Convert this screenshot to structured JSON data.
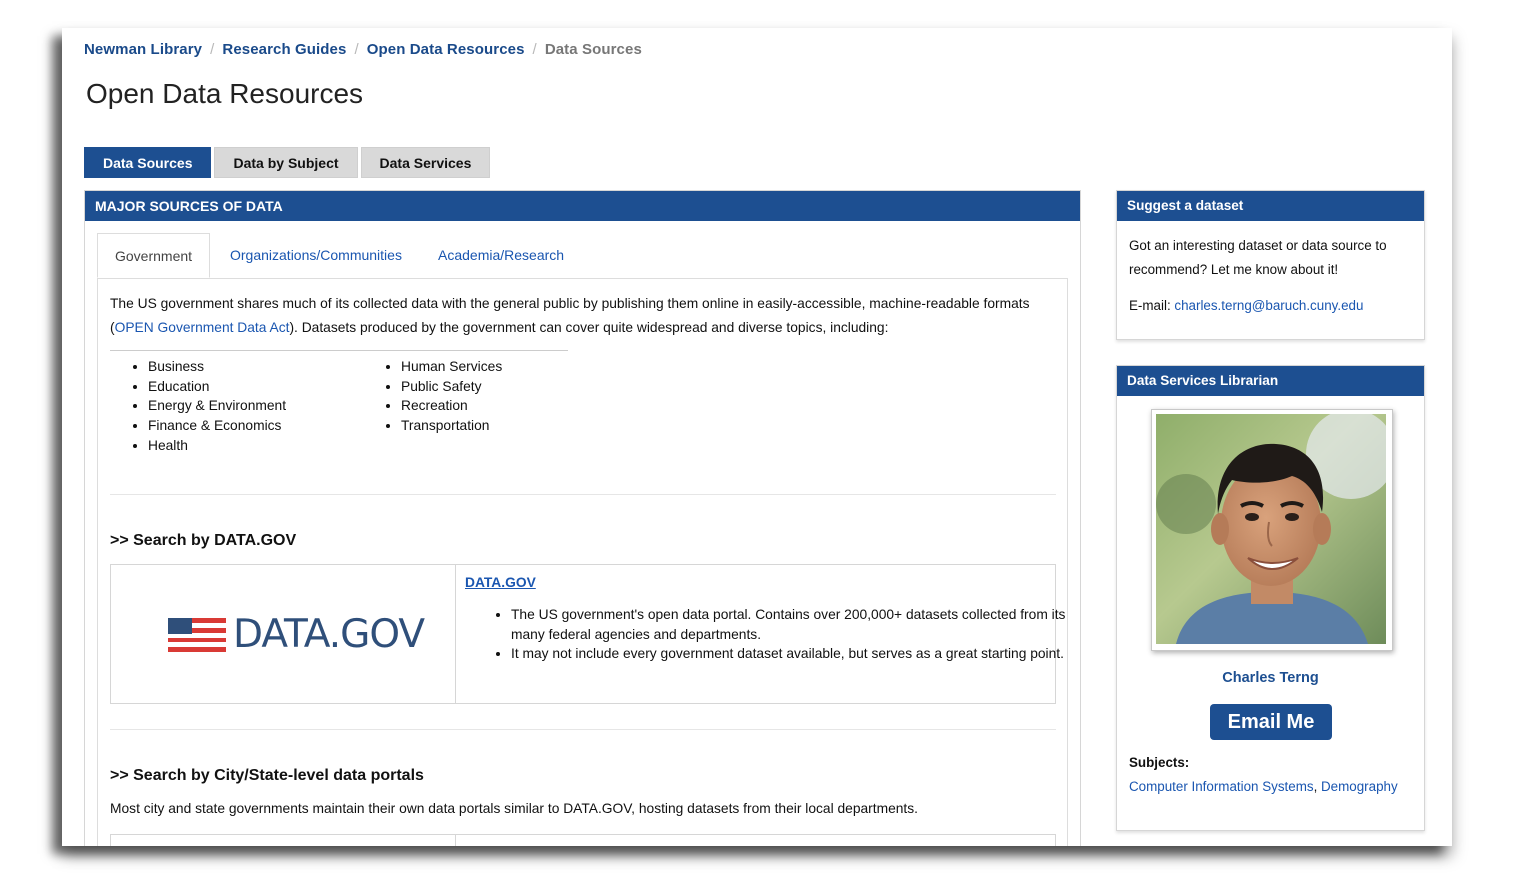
{
  "breadcrumb": {
    "items": [
      "Newman Library",
      "Research Guides",
      "Open Data Resources"
    ],
    "current": "Data Sources",
    "separator": "/"
  },
  "page_title": "Open Data Resources",
  "top_tabs": [
    "Data Sources",
    "Data by Subject",
    "Data Services"
  ],
  "main": {
    "header": "MAJOR SOURCES OF DATA",
    "inner_tabs": [
      "Government",
      "Organizations/Communities",
      "Academia/Research"
    ],
    "intro_before": "The US government shares much of its collected data with the general public by publishing them online in easily-accessible, machine-readable formats (",
    "intro_link": "OPEN Government Data Act",
    "intro_after": "). Datasets produced by the government can cover quite widespread and diverse topics, including:",
    "topics_col1": [
      "Business",
      "Education",
      "Energy & Environment",
      "Finance & Economics",
      "Health"
    ],
    "topics_col2": [
      "Human Services",
      "Public Safety",
      "Recreation",
      "Transportation"
    ],
    "datagov_heading": ">> Search by DATA.GOV",
    "datagov_logo_text": "DATA.GOV",
    "datagov_link": "DATA.GOV",
    "datagov_bullets": [
      "The US government's open data portal. Contains over 200,000+ datasets collected from its many federal agencies and departments.",
      "It may not include every government dataset available, but serves as a great starting point."
    ],
    "city_heading": ">> Search by City/State-level data portals",
    "city_text": "Most city and state governments maintain their own data portals similar to DATA.GOV, hosting datasets from their local departments."
  },
  "sidebar": {
    "suggest": {
      "header": "Suggest a dataset",
      "text": "Got an interesting dataset or data source to recommend? Let me know about it!",
      "email_label": "E-mail: ",
      "email": "charles.terng@baruch.cuny.edu"
    },
    "librarian": {
      "header": "Data Services Librarian",
      "name": "Charles Terng",
      "button": "Email Me",
      "subjects_label": "Subjects:",
      "subjects": [
        "Computer Information Systems",
        "Demography"
      ],
      "subjects_sep": ", "
    }
  },
  "colors": {
    "brand_blue": "#1d4f91",
    "link_blue": "#1a56b0",
    "tab_gray": "#d9d9d9"
  }
}
